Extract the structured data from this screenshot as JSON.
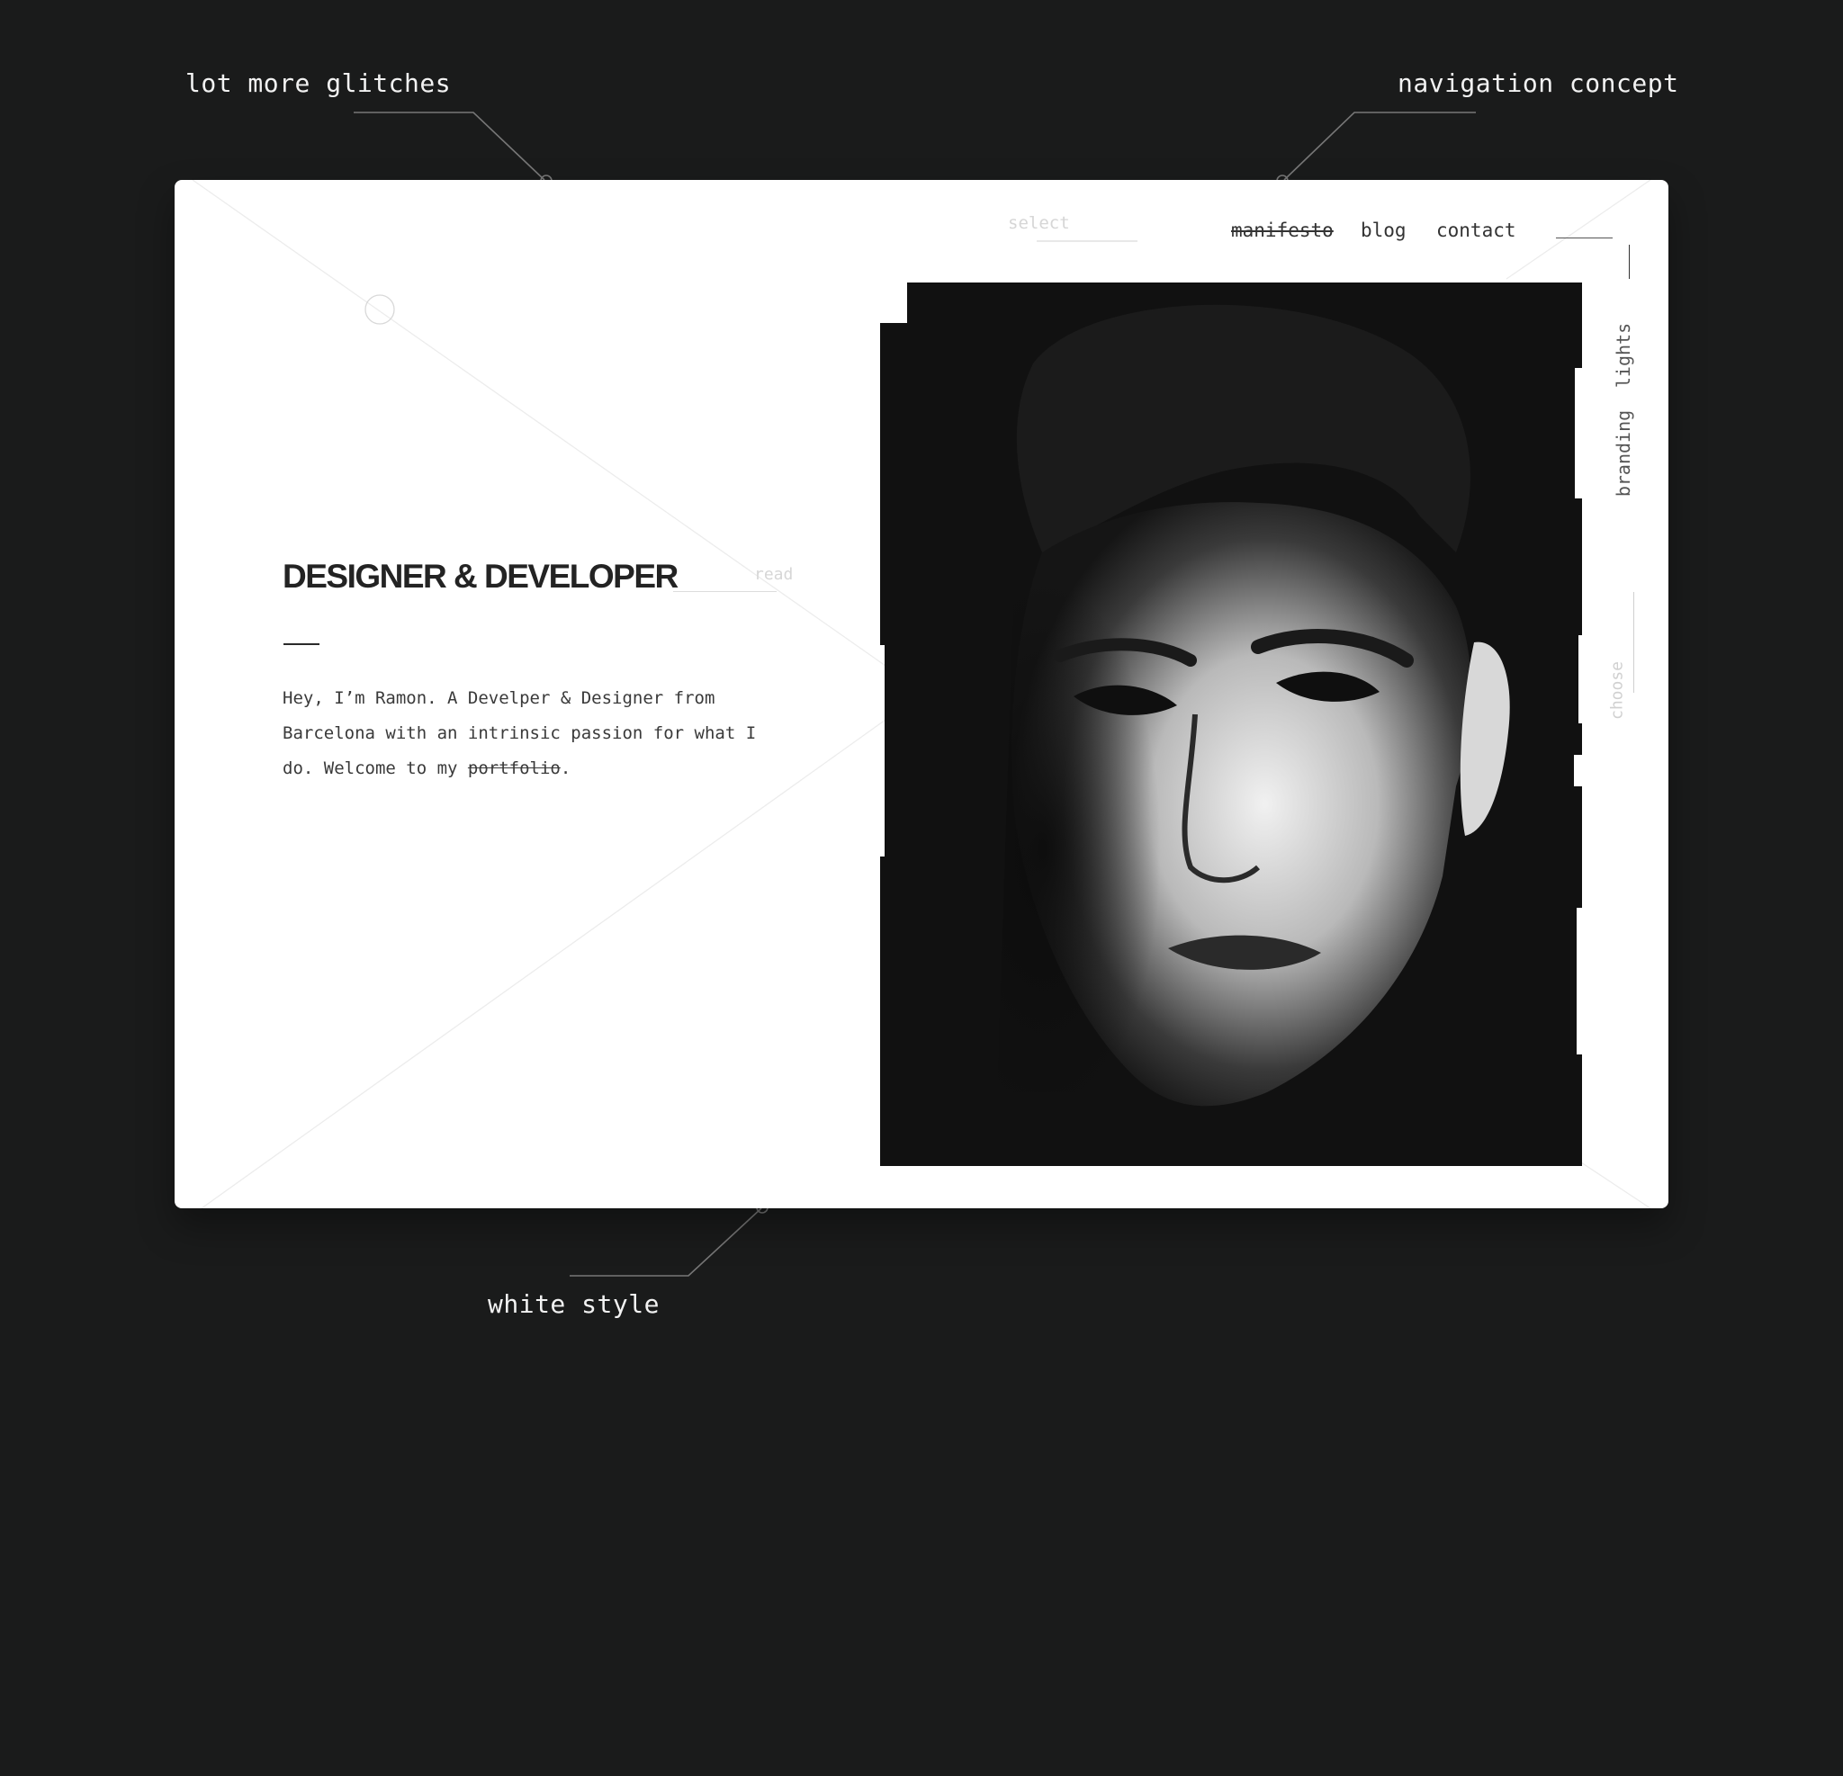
{
  "annotations": {
    "glitches": "lot more glitches",
    "navigation": "navigation concept",
    "white_style": "white style"
  },
  "card": {
    "select_label": "select",
    "nav": {
      "manifesto": "manifesto",
      "blog": "blog",
      "contact": "contact"
    },
    "headline": "DESIGNER & DEVELOPER",
    "read_label": "read",
    "intro": {
      "before": "Hey, I’m Ramon. A Develper & Designer from Barcelona with an intrinsic passion for what I do. Welcome to my ",
      "struck": "portfolio",
      "after": "."
    },
    "side_nav": {
      "lights": "lights",
      "branding": "branding",
      "choose": "choose"
    },
    "portrait_icon": "portrait-photo"
  },
  "colors": {
    "background": "#1a1b1b",
    "card": "#ffffff",
    "ink": "#232323",
    "muted": "#d6d6d6"
  }
}
